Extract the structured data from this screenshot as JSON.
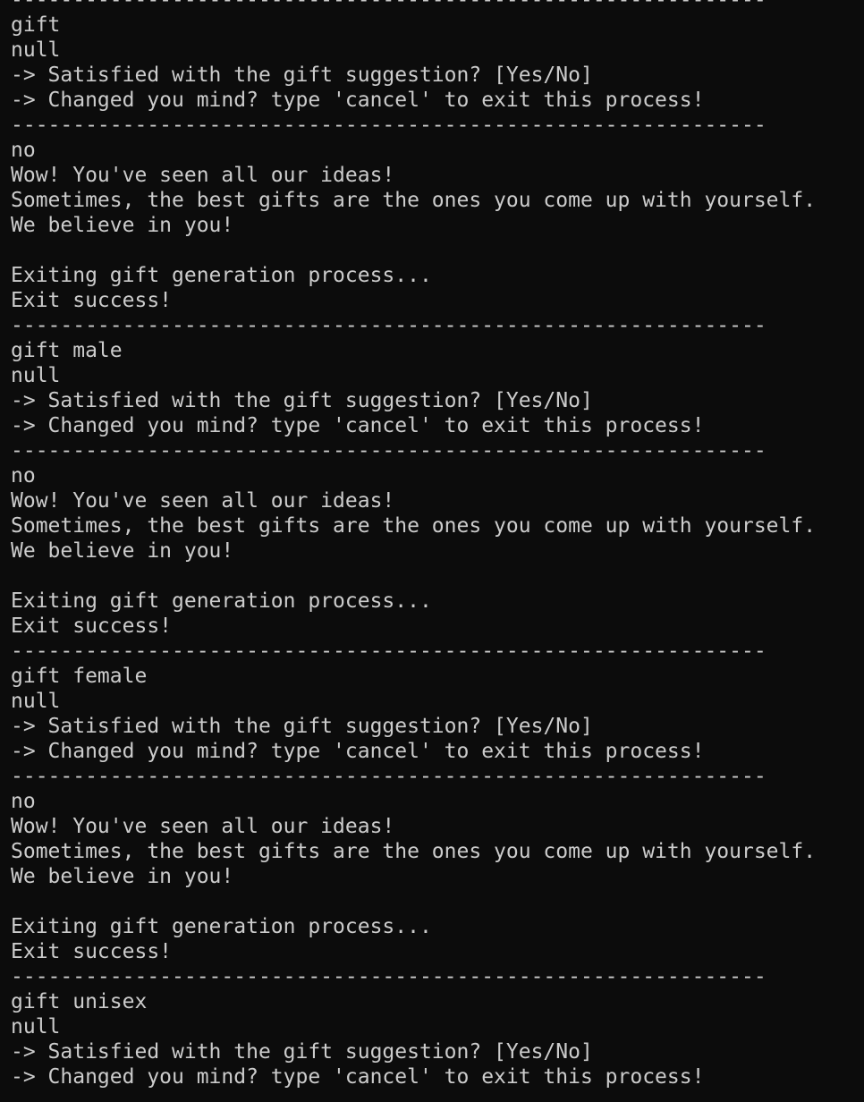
{
  "terminal": {
    "blocks": [
      {
        "separator": "-------------------------------------------------------------",
        "command": "gift",
        "output": "null",
        "prompt_satisfied": "-> Satisfied with the gift suggestion? [Yes/No]",
        "prompt_cancel": "-> Changed you mind? type 'cancel' to exit this process!"
      },
      {
        "separator": "-------------------------------------------------------------",
        "answer": "no",
        "msg_seen": "Wow! You've seen all our ideas!",
        "msg_best": "Sometimes, the best gifts are the ones you come up with yourself.",
        "msg_believe": "We believe in you!",
        "msg_exiting": "Exiting gift generation process...",
        "msg_success": "Exit success!"
      },
      {
        "separator": "-------------------------------------------------------------",
        "command": "gift male",
        "output": "null",
        "prompt_satisfied": "-> Satisfied with the gift suggestion? [Yes/No]",
        "prompt_cancel": "-> Changed you mind? type 'cancel' to exit this process!"
      },
      {
        "separator": "-------------------------------------------------------------",
        "answer": "no",
        "msg_seen": "Wow! You've seen all our ideas!",
        "msg_best": "Sometimes, the best gifts are the ones you come up with yourself.",
        "msg_believe": "We believe in you!",
        "msg_exiting": "Exiting gift generation process...",
        "msg_success": "Exit success!"
      },
      {
        "separator": "-------------------------------------------------------------",
        "command": "gift female",
        "output": "null",
        "prompt_satisfied": "-> Satisfied with the gift suggestion? [Yes/No]",
        "prompt_cancel": "-> Changed you mind? type 'cancel' to exit this process!"
      },
      {
        "separator": "-------------------------------------------------------------",
        "answer": "no",
        "msg_seen": "Wow! You've seen all our ideas!",
        "msg_best": "Sometimes, the best gifts are the ones you come up with yourself.",
        "msg_believe": "We believe in you!",
        "msg_exiting": "Exiting gift generation process...",
        "msg_success": "Exit success!"
      },
      {
        "separator": "-------------------------------------------------------------",
        "command": "gift unisex",
        "output": "null",
        "prompt_satisfied": "-> Satisfied with the gift suggestion? [Yes/No]",
        "prompt_cancel": "-> Changed you mind? type 'cancel' to exit this process!"
      }
    ]
  }
}
